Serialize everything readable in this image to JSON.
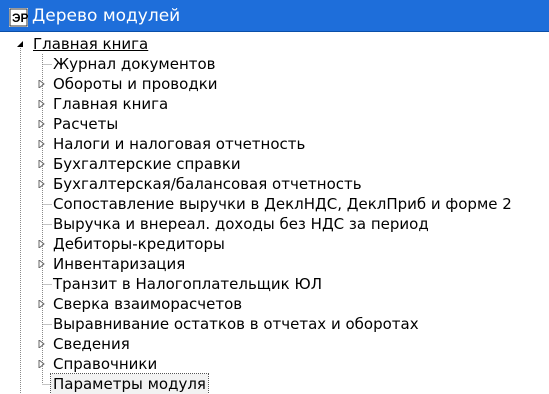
{
  "window": {
    "title": "Дерево модулей",
    "icon": "app-logo-icon"
  },
  "tree": {
    "root": {
      "label": "Главная книга",
      "expanded": true
    },
    "items": [
      {
        "label": "Журнал документов",
        "has_children": false
      },
      {
        "label": "Обороты и проводки",
        "has_children": true
      },
      {
        "label": "Главная книга",
        "has_children": true
      },
      {
        "label": "Расчеты",
        "has_children": true
      },
      {
        "label": "Налоги и налоговая отчетность",
        "has_children": true
      },
      {
        "label": "Бухгалтерские справки",
        "has_children": true
      },
      {
        "label": "Бухгалтерская/балансовая  отчетность",
        "has_children": true
      },
      {
        "label": "Сопоставление выручки в ДеклНДС, ДеклПриб и форме 2",
        "has_children": false
      },
      {
        "label": "Выручка и внереал. доходы без НДС за период",
        "has_children": false
      },
      {
        "label": "Дебиторы-кредиторы",
        "has_children": true
      },
      {
        "label": "Инвентаризация",
        "has_children": true
      },
      {
        "label": "Транзит в Налогоплательщик ЮЛ",
        "has_children": false
      },
      {
        "label": "Сверка взаиморасчетов",
        "has_children": true
      },
      {
        "label": "Выравнивание остатков в отчетах и оборотах",
        "has_children": false
      },
      {
        "label": "Сведения",
        "has_children": true
      },
      {
        "label": "Справочники",
        "has_children": true
      },
      {
        "label": "Параметры модуля",
        "has_children": false,
        "selected": true
      }
    ]
  },
  "colors": {
    "titlebar": "#1e6eda",
    "tree_lines": "#8a8a8a"
  }
}
